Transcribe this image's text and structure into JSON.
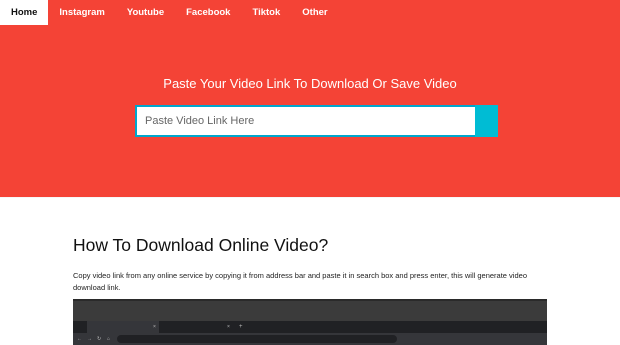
{
  "nav": {
    "items": [
      {
        "label": "Home",
        "active": true
      },
      {
        "label": "Instagram"
      },
      {
        "label": "Youtube"
      },
      {
        "label": "Facebook"
      },
      {
        "label": "Tiktok"
      },
      {
        "label": "Other"
      }
    ]
  },
  "hero": {
    "heading": "Paste Your Video Link To Download Or Save Video",
    "search_placeholder": "Paste Video Link Here"
  },
  "content": {
    "title": "How To Download Online Video?",
    "description": "Copy video link from any online service by copying it from address bar and paste it in search box and press enter, this will generate video download link."
  },
  "colors": {
    "brand": "#f44336",
    "accent": "#00bcd4"
  }
}
